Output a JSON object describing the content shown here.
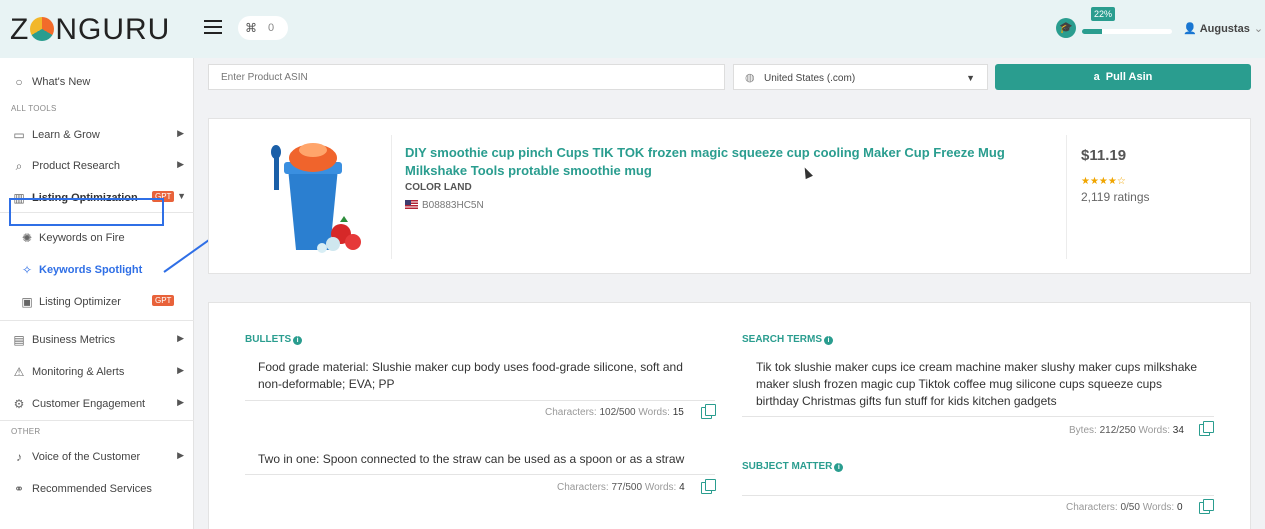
{
  "header": {
    "logo": "ZONGURU",
    "share_count": "0",
    "progress_label": "22%",
    "progress_value": 22,
    "user_name": "Augustas"
  },
  "sidebar": {
    "whats_new": "What's New",
    "section_all_tools": "ALL TOOLS",
    "learn_grow": "Learn & Grow",
    "product_research": "Product Research",
    "listing_optimization": "Listing Optimization",
    "gpt_badge": "GPT",
    "keywords_on_fire": "Keywords on Fire",
    "keywords_spotlight": "Keywords Spotlight",
    "listing_optimizer": "Listing Optimizer",
    "business_metrics": "Business Metrics",
    "monitoring_alerts": "Monitoring & Alerts",
    "customer_engagement": "Customer Engagement",
    "section_other": "OTHER",
    "voice_of_customer": "Voice of the Customer",
    "recommended_services": "Recommended Services"
  },
  "search": {
    "asin_placeholder": "Enter Product ASIN",
    "marketplace": "United States (.com)",
    "pull_button": "Pull Asin"
  },
  "product": {
    "title": "DIY smoothie cup pinch Cups TIK TOK frozen magic squeeze cup cooling Maker Cup Freeze Mug Milkshake Tools protable smoothie mug",
    "brand": "COLOR LAND",
    "asin": "B08883HC5N",
    "price": "$11.19",
    "rating": 4,
    "stars": "★★★★☆",
    "ratings_count": "2,119 ratings"
  },
  "listing": {
    "bullets_label": "BULLETS",
    "bullets": [
      {
        "text": "Food grade material: Slushie maker cup body uses food-grade silicone, soft and non-deformable; EVA; PP",
        "chars_label": "Characters:",
        "chars": "102/500",
        "words_label": "Words:",
        "words": "15"
      },
      {
        "text": "Two in one: Spoon connected to the straw can be used as a spoon or as a straw",
        "chars_label": "Characters:",
        "chars": "77/500",
        "words_label": "Words:",
        "words": "4"
      }
    ],
    "search_terms_label": "SEARCH TERMS",
    "search_terms": {
      "text": "Tik tok slushie maker cups ice cream machine maker slushy maker cups milkshake maker slush frozen magic cup Tiktok coffee mug silicone cups squeeze cups birthday Christmas gifts fun stuff for kids kitchen gadgets",
      "bytes_label": "Bytes:",
      "bytes": "212/250",
      "words_label": "Words:",
      "words": "34"
    },
    "subject_matter_label": "SUBJECT MATTER",
    "subject_matter": {
      "chars_label": "Characters:",
      "chars": "0/50",
      "words_label": "Words:",
      "words": "0"
    }
  },
  "colors": {
    "accent": "#2a9d8f",
    "highlight": "#2f6fe6",
    "gpt": "#e8623a"
  }
}
